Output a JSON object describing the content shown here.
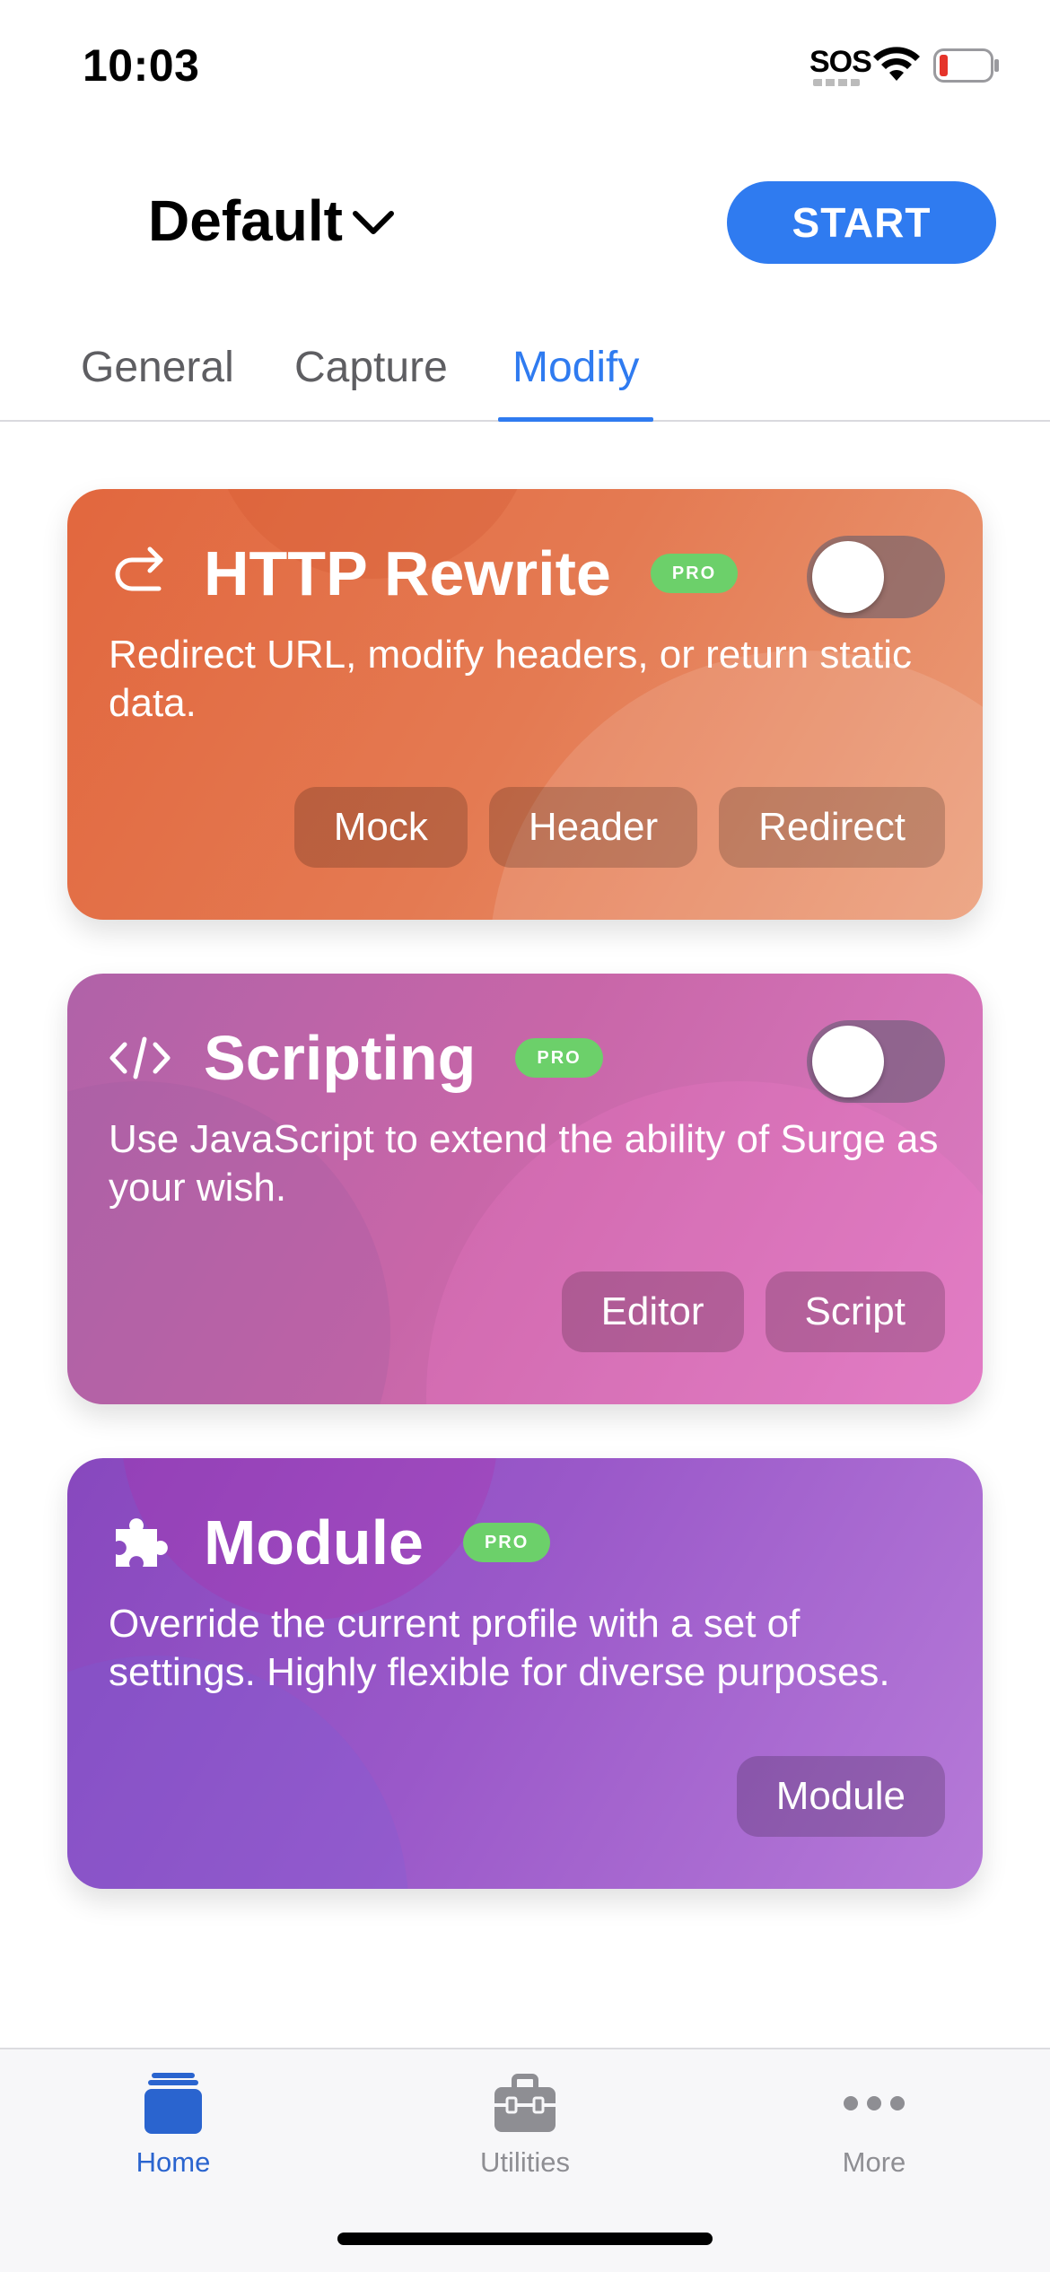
{
  "status_bar": {
    "time": "10:03",
    "sos": "SOS"
  },
  "header": {
    "profile_name": "Default",
    "start_label": "START"
  },
  "tabs": [
    {
      "label": "General",
      "active": false
    },
    {
      "label": "Capture",
      "active": false
    },
    {
      "label": "Modify",
      "active": true
    }
  ],
  "cards": [
    {
      "title": "HTTP Rewrite",
      "badge": "PRO",
      "description": "Redirect URL, modify headers, or return static data.",
      "toggle_on": false,
      "chips": [
        "Mock",
        "Header",
        "Redirect"
      ],
      "icon": "redirect-arrow-icon"
    },
    {
      "title": "Scripting",
      "badge": "PRO",
      "description": "Use JavaScript to extend the ability of Surge as your wish.",
      "toggle_on": false,
      "chips": [
        "Editor",
        "Script"
      ],
      "icon": "code-icon"
    },
    {
      "title": "Module",
      "badge": "PRO",
      "description": "Override the current profile with a set of settings. Highly flexible for diverse purposes.",
      "chips": [
        "Module"
      ],
      "icon": "puzzle-icon"
    }
  ],
  "tabbar": [
    {
      "label": "Home",
      "active": true,
      "icon": "home-icon"
    },
    {
      "label": "Utilities",
      "active": false,
      "icon": "toolbox-icon"
    },
    {
      "label": "More",
      "active": false,
      "icon": "more-icon"
    }
  ],
  "colors": {
    "accent": "#2f7bf0",
    "pro_badge": "#6cd06a",
    "rewrite_card": "#e2673e",
    "scripting_card": "#c866a8",
    "module_card": "#9a58c9"
  }
}
